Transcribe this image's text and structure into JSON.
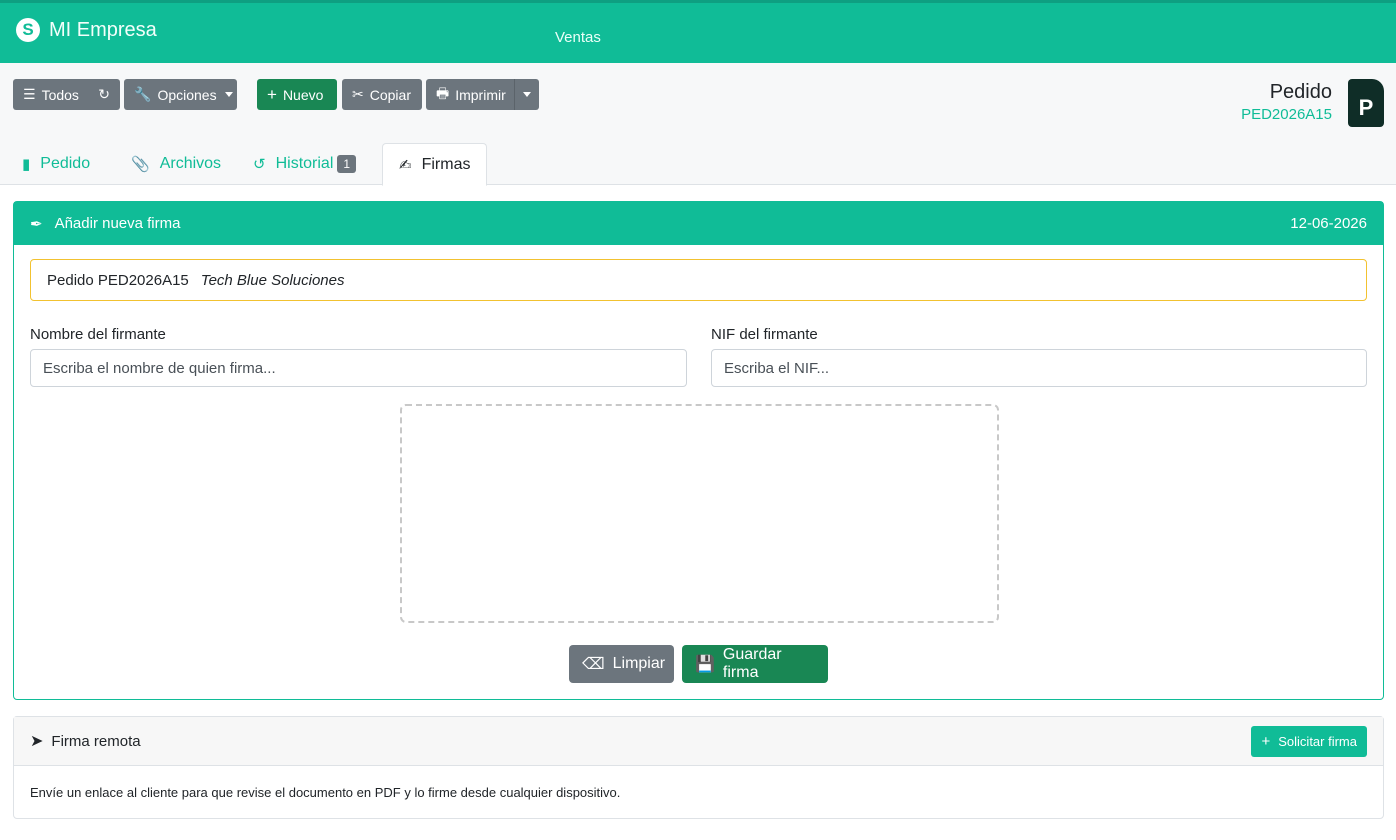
{
  "navbar": {
    "brand": "MI Empresa",
    "brand_logo": "S",
    "link": "Ventas",
    "color": "#10bc97"
  },
  "toolbar": {
    "todos": "Todos",
    "opciones": "Opciones",
    "nuevo": "Nuevo",
    "copiar": "Copiar",
    "imprimir": "Imprimir"
  },
  "document": {
    "type": "Pedido",
    "code": "PED2026A15",
    "icon_letter": "P"
  },
  "tabs": [
    {
      "label": "Pedido"
    },
    {
      "label": "Archivos"
    },
    {
      "label": "Historial",
      "badge": "1"
    },
    {
      "label": "Firmas",
      "active": true
    }
  ],
  "new_signature": {
    "title": "Añadir nueva firma",
    "date": "12-06-2026",
    "doc_label": "Pedido PED2026A15",
    "client": "Tech Blue Soluciones",
    "name_label": "Nombre del firmante",
    "name_placeholder": "Escriba el nombre de quien firma...",
    "nif_label": "NIF del firmante",
    "nif_placeholder": "Escriba el NIF...",
    "clear_button": "Limpiar",
    "save_button": "Guardar firma"
  },
  "remote_signature": {
    "title": "Firma remota",
    "request_button": "Solicitar firma",
    "description": "Envíe un enlace al cliente para que revise el documento en PDF y lo firme desde cualquier dispositivo."
  }
}
